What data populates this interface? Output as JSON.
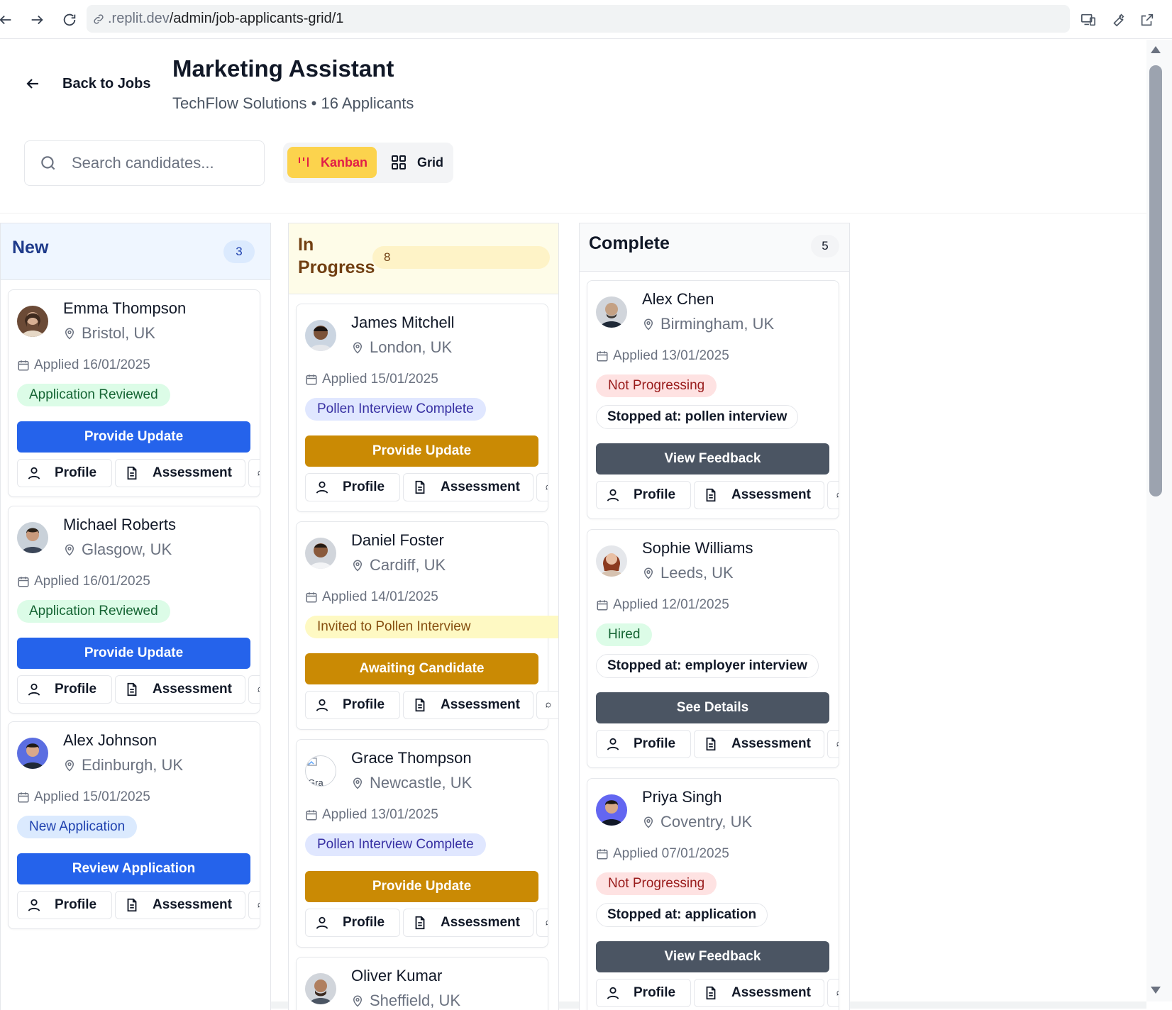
{
  "browser": {
    "url_host": ".replit.dev",
    "url_path": "/admin/job-applicants-grid/1"
  },
  "header": {
    "back_label": "Back to Jobs",
    "title": "Marketing Assistant",
    "subtitle": "TechFlow Solutions • 16 Applicants"
  },
  "search": {
    "placeholder": "Search candidates..."
  },
  "view_toggle": {
    "kanban": "Kanban",
    "grid": "Grid",
    "active": "Kanban"
  },
  "buttons": {
    "profile": "Profile",
    "assessment": "Assessment"
  },
  "columns": [
    {
      "title": "New",
      "count": "3",
      "cards": [
        {
          "name": "Emma Thompson",
          "location": "Bristol, UK",
          "applied": "Applied 16/01/2025",
          "status": "Application Reviewed",
          "action": "Provide Update"
        },
        {
          "name": "Michael Roberts",
          "location": "Glasgow, UK",
          "applied": "Applied 16/01/2025",
          "status": "Application Reviewed",
          "action": "Provide Update"
        },
        {
          "name": "Alex Johnson",
          "location": "Edinburgh, UK",
          "applied": "Applied 15/01/2025",
          "status": "New Application",
          "action": "Review Application"
        }
      ]
    },
    {
      "title_line1": "In",
      "title_line2": "Progress",
      "count": "8",
      "cards": [
        {
          "name": "James Mitchell",
          "location": "London, UK",
          "applied": "Applied 15/01/2025",
          "status": "Pollen Interview Complete",
          "action": "Provide Update"
        },
        {
          "name": "Daniel Foster",
          "location": "Cardiff, UK",
          "applied": "Applied 14/01/2025",
          "status": "Invited to Pollen Interview",
          "action": "Awaiting Candidate"
        },
        {
          "name": "Grace Thompson",
          "location": "Newcastle, UK",
          "applied": "Applied 13/01/2025",
          "status": "Pollen Interview Complete",
          "action": "Provide Update",
          "avatar_alt": "Gra"
        },
        {
          "name": "Oliver Kumar",
          "location": "Sheffield, UK"
        }
      ]
    },
    {
      "title": "Complete",
      "count": "5",
      "cards": [
        {
          "name": "Alex Chen",
          "location": "Birmingham, UK",
          "applied": "Applied 13/01/2025",
          "status": "Not Progressing",
          "stopped": "Stopped at: pollen interview",
          "action": "View Feedback"
        },
        {
          "name": "Sophie Williams",
          "location": "Leeds, UK",
          "applied": "Applied 12/01/2025",
          "status": "Hired",
          "stopped": "Stopped at: employer interview",
          "action": "See Details"
        },
        {
          "name": "Priya Singh",
          "location": "Coventry, UK",
          "applied": "Applied 07/01/2025",
          "status": "Not Progressing",
          "stopped": "Stopped at: application",
          "action": "View Feedback"
        }
      ]
    }
  ],
  "colors": {
    "primary_blue": "#2563eb",
    "gold": "#ca8a04",
    "slate": "#4b5563",
    "kanban_active": "#fcd34d"
  }
}
